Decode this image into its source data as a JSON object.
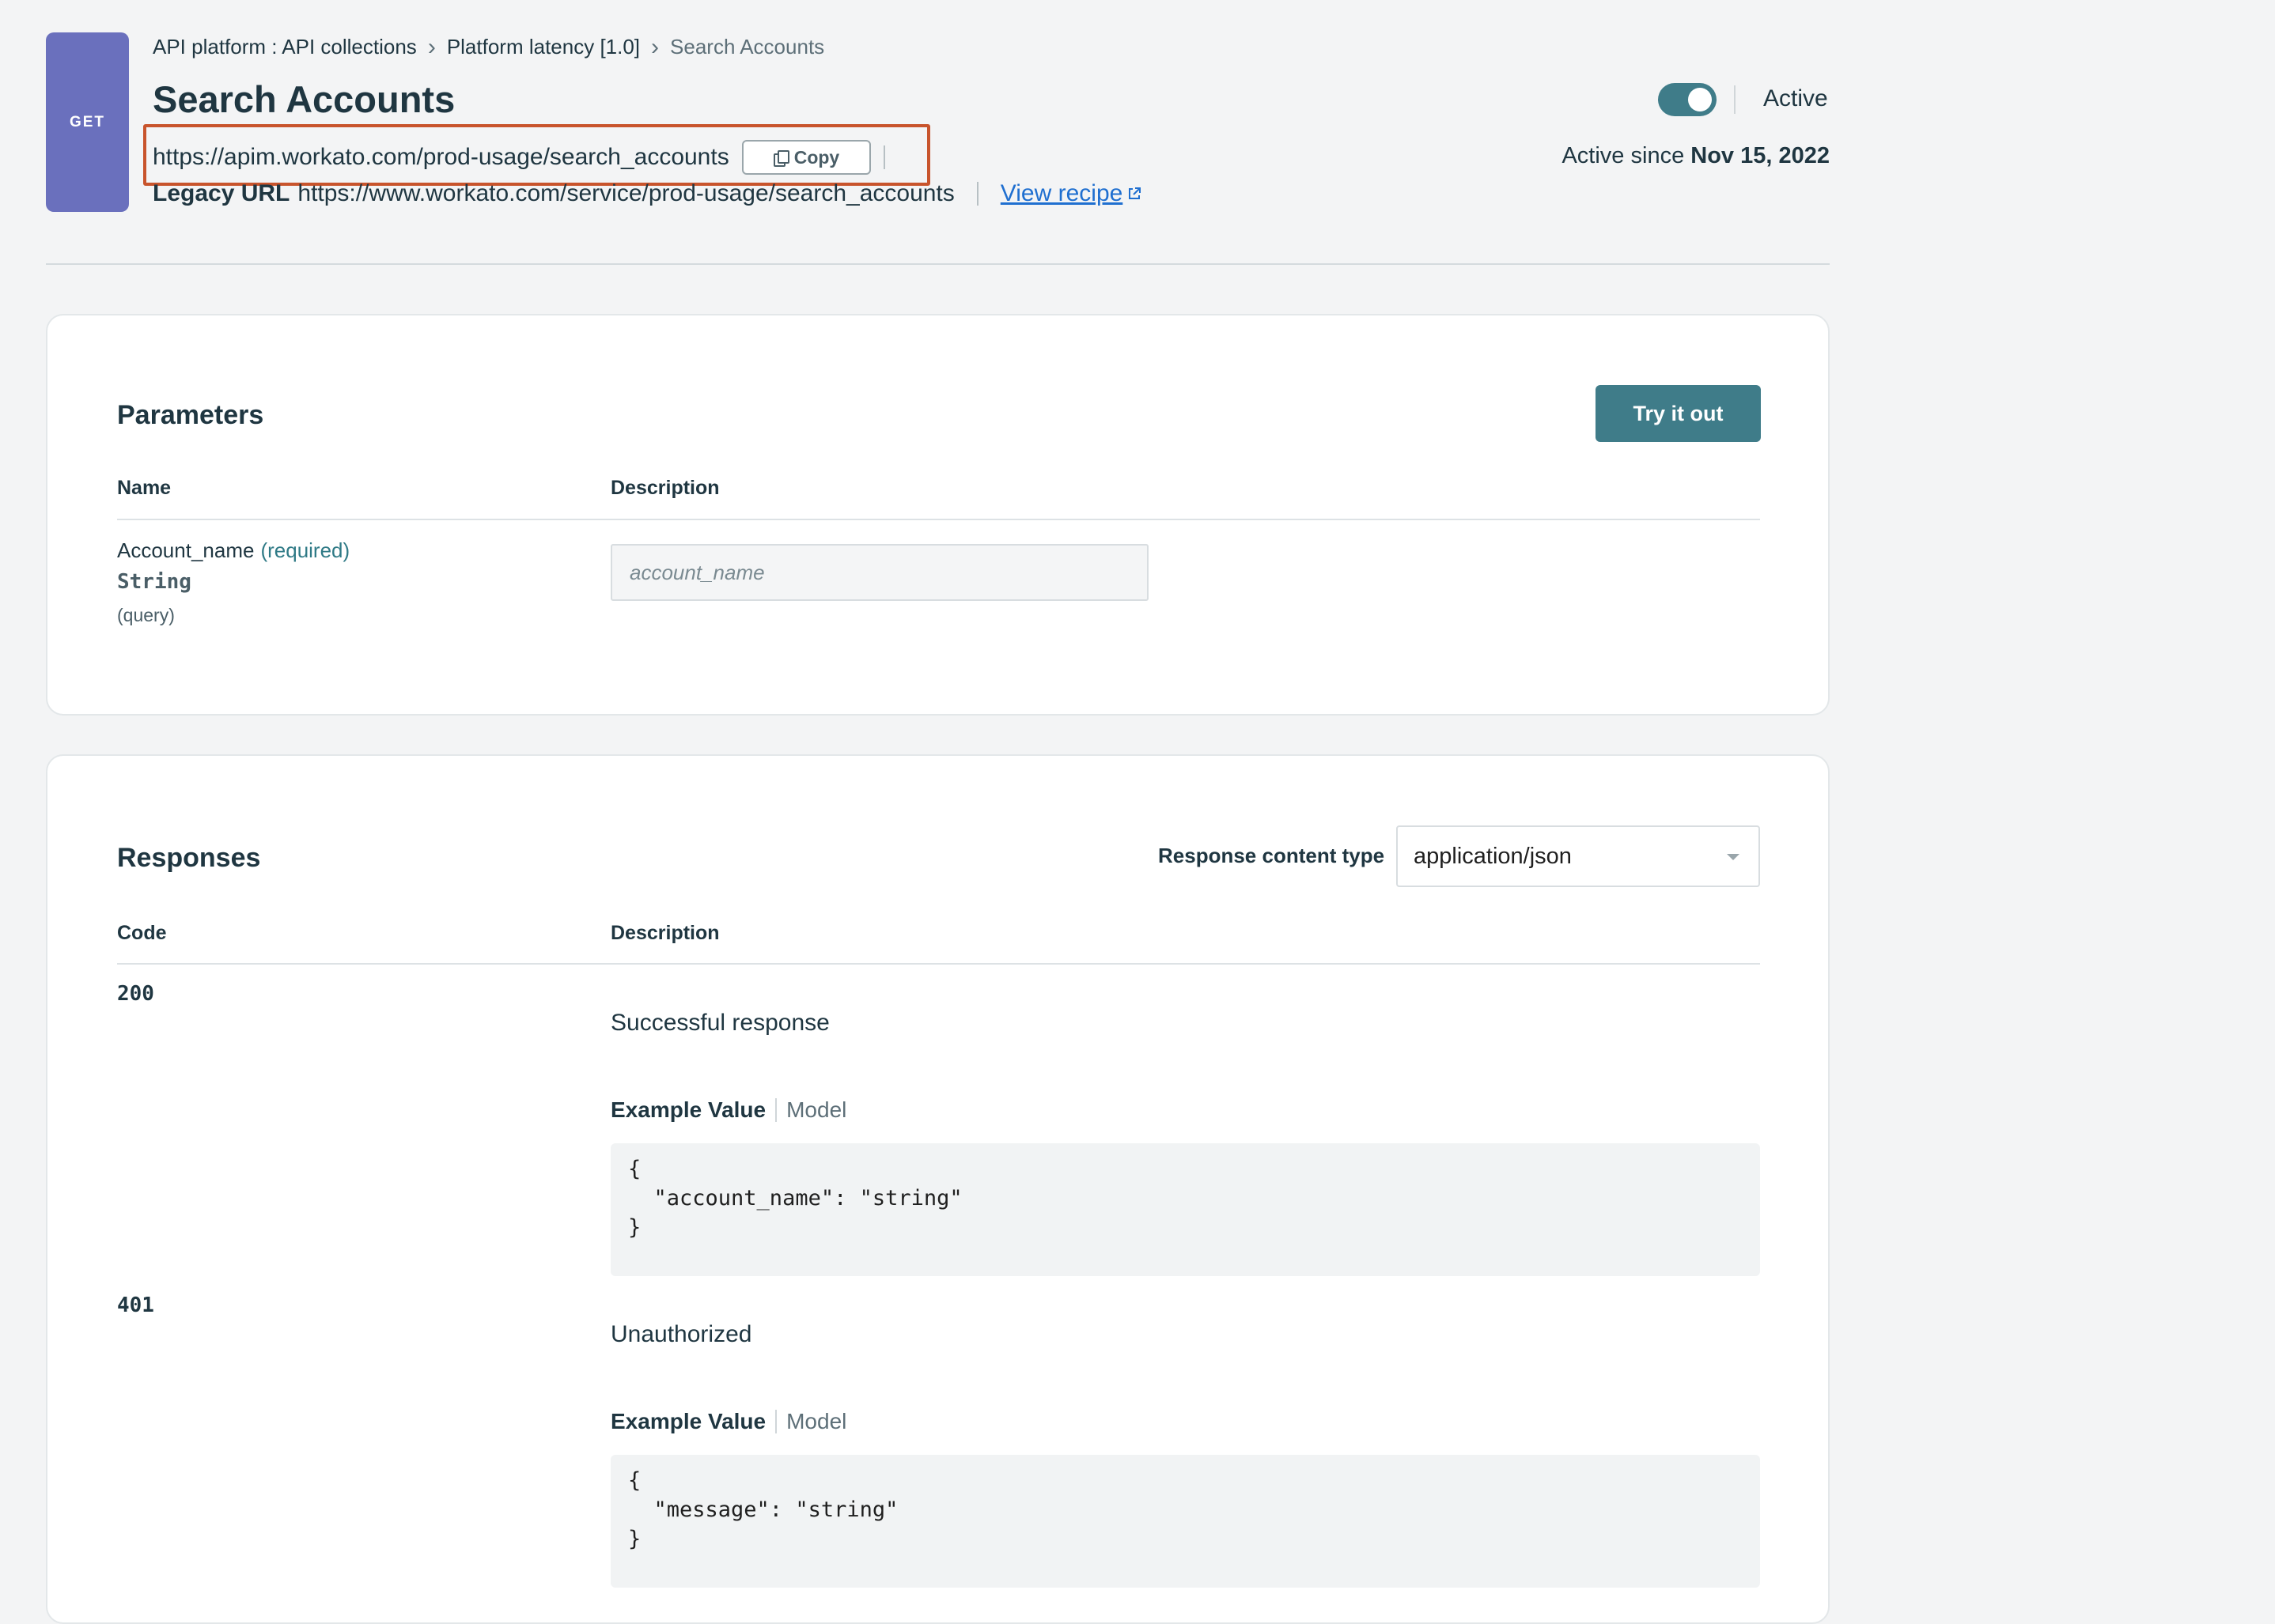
{
  "method": "GET",
  "breadcrumb": [
    {
      "label": "API platform : API collections"
    },
    {
      "label": "Platform latency [1.0]"
    },
    {
      "label": "Search Accounts"
    }
  ],
  "title": "Search Accounts",
  "url": "https://apim.workato.com/prod-usage/search_accounts",
  "copy_label": "Copy",
  "legacy": {
    "label": "Legacy URL",
    "url": "https://www.workato.com/service/prod-usage/search_accounts",
    "view_recipe": "View recipe"
  },
  "status": {
    "label": "Active",
    "enabled": true,
    "since_prefix": "Active since",
    "since_date": "Nov 15, 2022"
  },
  "parameters": {
    "title": "Parameters",
    "try_label": "Try it out",
    "col_name": "Name",
    "col_description": "Description",
    "items": [
      {
        "name": "Account_name",
        "required": "(required)",
        "type": "String",
        "in": "(query)",
        "placeholder": "account_name"
      }
    ]
  },
  "responses": {
    "title": "Responses",
    "content_type_label": "Response content type",
    "content_type": "application/json",
    "col_code": "Code",
    "col_description": "Description",
    "example_label": "Example Value",
    "model_label": "Model",
    "items": [
      {
        "code": "200",
        "description": "Successful response",
        "example": "{\n  \"account_name\": \"string\"\n}"
      },
      {
        "code": "401",
        "description": "Unauthorized",
        "example": "{\n  \"message\": \"string\"\n}"
      }
    ]
  },
  "colors": {
    "method_badge": "#6a70bd",
    "primary": "#3f7c89",
    "highlight_box": "#c8542c",
    "link": "#1f6fd0"
  },
  "icons": [
    "copy-icon",
    "chevron-right-icon",
    "external-link-icon",
    "caret-down-icon"
  ]
}
